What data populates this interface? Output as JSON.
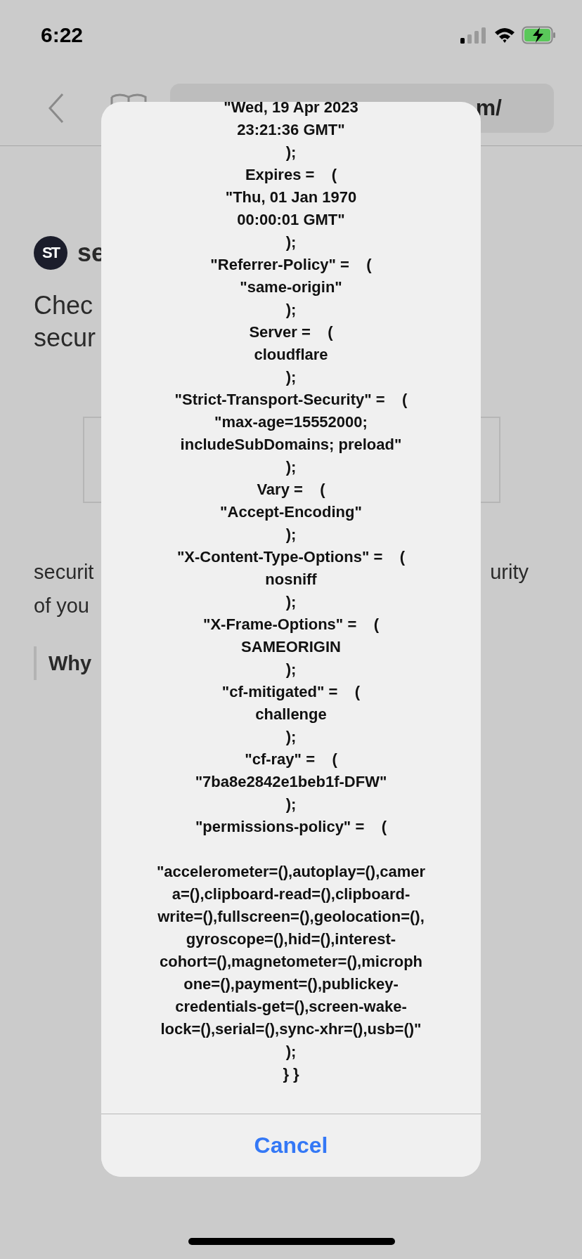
{
  "status_bar": {
    "time": "6:22"
  },
  "browser": {
    "url_field": {
      "value": "m/"
    }
  },
  "page": {
    "logo_text": "ST",
    "site_name": "se",
    "heading_lines": [
      "Chec",
      "secur"
    ],
    "paragraph_left": [
      "securit",
      "of you"
    ],
    "paragraph_right": "urity",
    "quote": "Why"
  },
  "dialog": {
    "blocks": [
      {
        "lines": [
          "\"Wed, 19 Apr 2023",
          "23:21:36 GMT\"",
          ");",
          "Expires =    (",
          "\"Thu, 01 Jan 1970",
          "00:00:01 GMT\"",
          ");",
          "\"Referrer-Policy\" =    (",
          "\"same-origin\"",
          ");",
          "Server =    (",
          "cloudflare",
          ");",
          "\"Strict-Transport-Security\" =    (",
          "\"max-age=15552000;",
          "includeSubDomains; preload\"",
          ");",
          "Vary =    (",
          "\"Accept-Encoding\"",
          ");",
          "\"X-Content-Type-Options\" =    (",
          "nosniff",
          ");",
          "\"X-Frame-Options\" =    (",
          "SAMEORIGIN",
          ");",
          "\"cf-mitigated\" =    (",
          "challenge",
          ");",
          "\"cf-ray\" =    (",
          "\"7ba8e2842e1beb1f-DFW\"",
          ");",
          "\"permissions-policy\" =    ("
        ]
      },
      {
        "lines": [
          "\"accelerometer=(),autoplay=(),camer",
          "a=(),clipboard-read=(),clipboard-",
          "write=(),fullscreen=(),geolocation=(),",
          "gyroscope=(),hid=(),interest-",
          "cohort=(),magnetometer=(),microph",
          "one=(),payment=(),publickey-",
          "credentials-get=(),screen-wake-",
          "lock=(),serial=(),sync-xhr=(),usb=()\"",
          ");",
          "} }"
        ]
      }
    ],
    "cancel": "Cancel"
  }
}
